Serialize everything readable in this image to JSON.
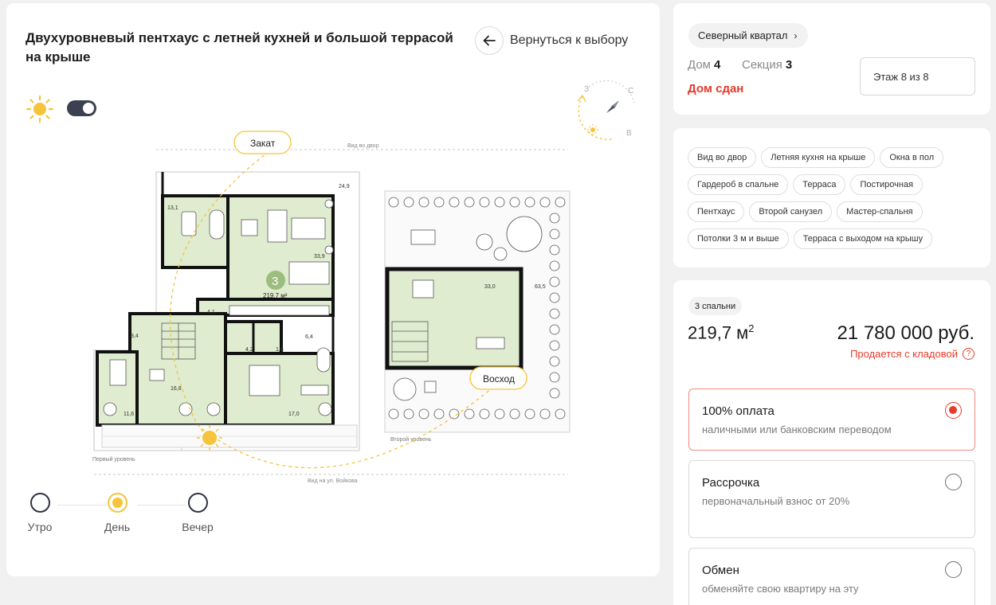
{
  "title": "Двухуровневый пентхаус с летней кухней и большой террасой на крыше",
  "back_label": "Вернуться к выбору",
  "compass": {
    "n": "С",
    "w": "З",
    "e": "В"
  },
  "plan": {
    "sunset": "Закат",
    "sunrise": "Восход",
    "view_yard": "Вид во двор",
    "view_street": "Вид на ул. Войкова",
    "level1": "Первый уровень",
    "level2": "Второй уровень",
    "total_area": "219,7 м²",
    "rooms_badge": "3",
    "room_areas": [
      "24,9",
      "13,1",
      "33,9",
      "4,1",
      "3,4",
      "4,2",
      "1,8",
      "6,4",
      "16,8",
      "11,6",
      "17,0",
      "33,0",
      "63,5"
    ]
  },
  "times": [
    {
      "label": "Утро",
      "active": false
    },
    {
      "label": "День",
      "active": true
    },
    {
      "label": "Вечер",
      "active": false
    }
  ],
  "info": {
    "quarter": "Северный квартал",
    "house_label": "Дом",
    "house_value": "4",
    "section_label": "Секция",
    "section_value": "3",
    "status": "Дом сдан",
    "floor": "Этаж 8 из 8"
  },
  "tags": [
    "Вид во двор",
    "Летняя кухня на крыше",
    "Окна в пол",
    "Гардероб в спальне",
    "Терраса",
    "Постирочная",
    "Пентхаус",
    "Второй санузел",
    "Мастер-спальня",
    "Потолки 3 м и выше",
    "Терраса с выходом на крышу"
  ],
  "offer": {
    "rooms": "3 спальни",
    "area": "219,7 м",
    "area_unit": "2",
    "price": "21 780 000 руб.",
    "storage_note": "Продается с кладовой",
    "storage_q": "?"
  },
  "payment_options": [
    {
      "title": "100% оплата",
      "sub": "наличными или банковским переводом",
      "selected": true
    },
    {
      "title": "Рассрочка",
      "sub": "первоначальный взнос от 20%",
      "selected": false
    },
    {
      "title": "Обмен",
      "sub": "обменяйте свою квартиру на эту",
      "selected": false
    }
  ],
  "colors": {
    "accent": "#e53b2c",
    "sun": "#f5c43a",
    "room_fill": "#dfeccf",
    "wall": "#111111"
  }
}
